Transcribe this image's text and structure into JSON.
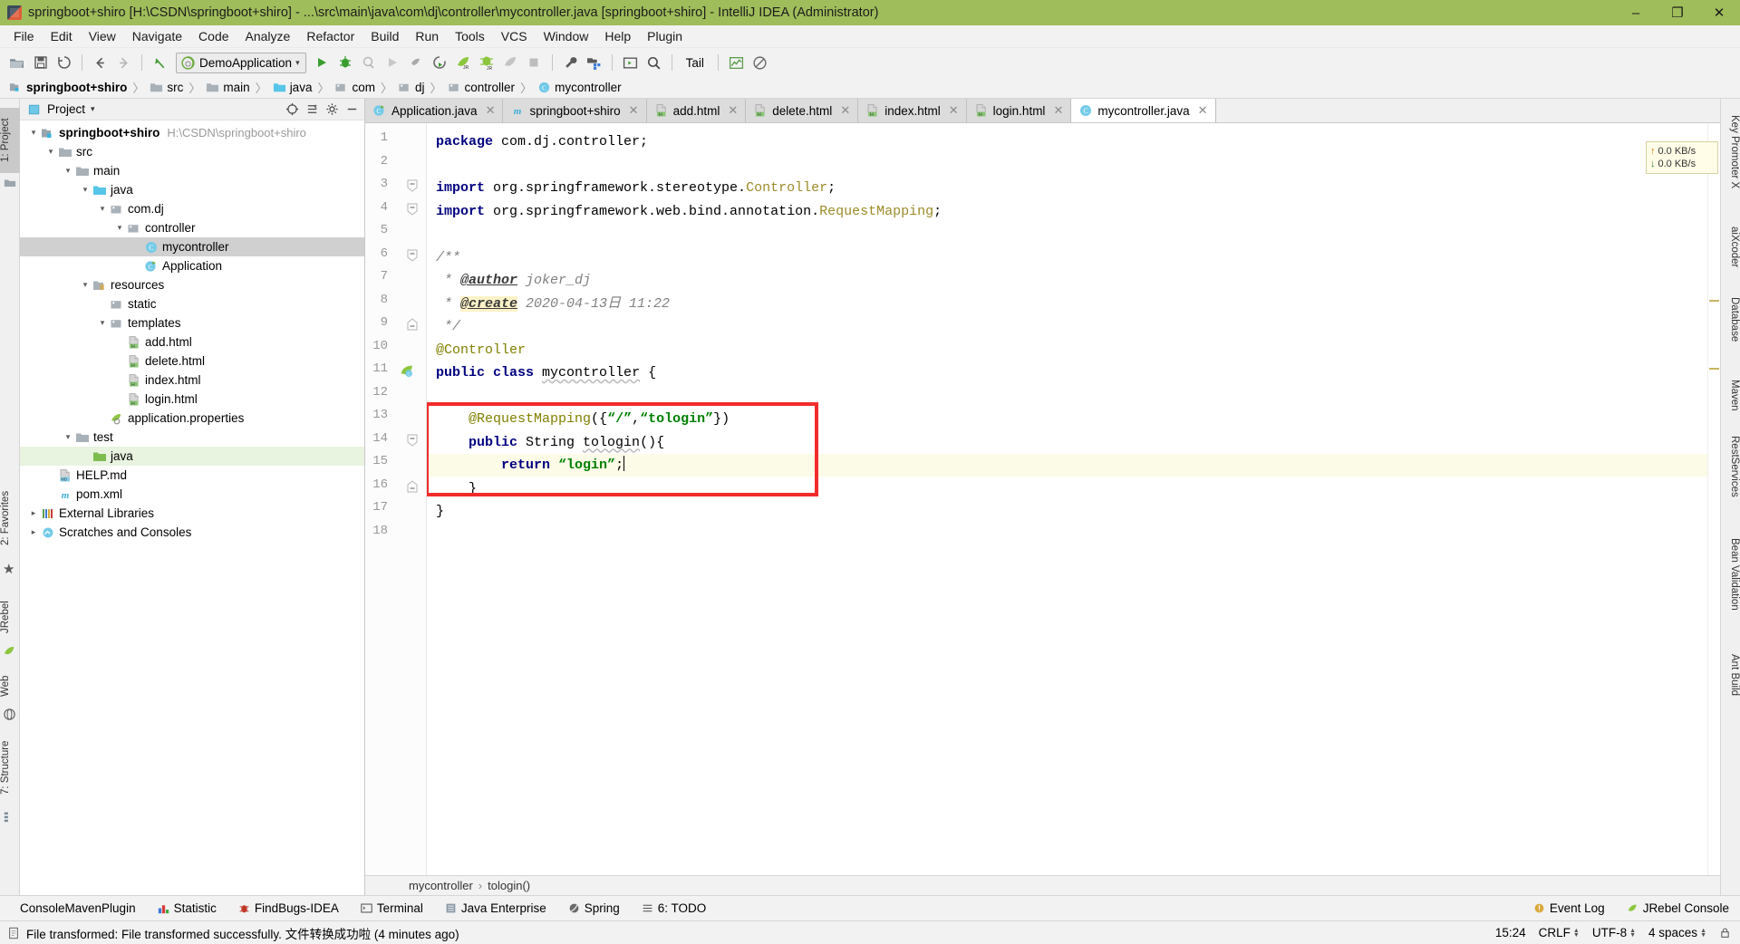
{
  "window": {
    "title": "springboot+shiro [H:\\CSDN\\springboot+shiro] - ...\\src\\main\\java\\com\\dj\\controller\\mycontroller.java [springboot+shiro] - IntelliJ IDEA (Administrator)",
    "minimize": "–",
    "maximize": "❐",
    "close": "✕",
    "titlebar_color": "#9fbd5a"
  },
  "menubar": {
    "items": [
      "File",
      "Edit",
      "View",
      "Navigate",
      "Code",
      "Analyze",
      "Refactor",
      "Build",
      "Run",
      "Tools",
      "VCS",
      "Window",
      "Help",
      "Plugin"
    ]
  },
  "toolbar": {
    "run_config": "DemoApplication",
    "tail_label": "Tail",
    "icons": [
      "open-folder-icon",
      "save-all-icon",
      "sync-icon",
      "back-arrow-icon",
      "forward-arrow-icon",
      "revert-icon",
      "run-icon",
      "debug-icon",
      "run-with-coverage-icon",
      "rerun-icon",
      "stop-gray-icon",
      "restart-icon",
      "jrebel-run-icon",
      "jrebel-debug-icon",
      "jrebel-gray-icon",
      "stop-icon",
      "wrench-icon",
      "project-structure-icon",
      "terminal-icon",
      "search-everywhere-icon"
    ]
  },
  "breadcrumb": {
    "items": [
      {
        "label": "springboot+shiro",
        "icon": "module-icon",
        "bold": true
      },
      {
        "label": "src",
        "icon": "folder-icon",
        "bold": false
      },
      {
        "label": "main",
        "icon": "folder-icon",
        "bold": false
      },
      {
        "label": "java",
        "icon": "source-folder-icon",
        "bold": false
      },
      {
        "label": "com",
        "icon": "package-icon",
        "bold": false
      },
      {
        "label": "dj",
        "icon": "package-icon",
        "bold": false
      },
      {
        "label": "controller",
        "icon": "package-icon",
        "bold": false
      },
      {
        "label": "mycontroller",
        "icon": "class-icon",
        "bold": false
      }
    ],
    "separator": "〉"
  },
  "project_panel": {
    "title": "Project",
    "dropdown_caret": "▾",
    "header_icons": [
      "locate-icon",
      "collapse-all-icon",
      "settings-gear-icon",
      "hide-icon"
    ],
    "tree": [
      {
        "depth": 0,
        "label": "springboot+shiro",
        "path": "H:\\CSDN\\springboot+shiro",
        "icon": "module-icon",
        "twist": "▾",
        "bold": true,
        "state": "normal"
      },
      {
        "depth": 1,
        "label": "src",
        "icon": "folder-icon",
        "twist": "▾",
        "bold": false,
        "state": "normal"
      },
      {
        "depth": 2,
        "label": "main",
        "icon": "folder-icon",
        "twist": "▾",
        "bold": false,
        "state": "normal"
      },
      {
        "depth": 3,
        "label": "java",
        "icon": "source-folder-icon",
        "twist": "▾",
        "bold": false,
        "state": "normal"
      },
      {
        "depth": 4,
        "label": "com.dj",
        "icon": "package-icon",
        "twist": "▾",
        "bold": false,
        "state": "normal"
      },
      {
        "depth": 5,
        "label": "controller",
        "icon": "package-icon",
        "twist": "▾",
        "bold": false,
        "state": "normal"
      },
      {
        "depth": 6,
        "label": "mycontroller",
        "icon": "class-icon",
        "twist": "",
        "bold": false,
        "state": "selected"
      },
      {
        "depth": 6,
        "label": "Application",
        "icon": "spring-class-icon",
        "twist": "",
        "bold": false,
        "state": "normal"
      },
      {
        "depth": 3,
        "label": "resources",
        "icon": "resources-folder-icon",
        "twist": "▾",
        "bold": false,
        "state": "normal"
      },
      {
        "depth": 4,
        "label": "static",
        "icon": "package-icon",
        "twist": "",
        "bold": false,
        "state": "normal"
      },
      {
        "depth": 4,
        "label": "templates",
        "icon": "package-icon",
        "twist": "▾",
        "bold": false,
        "state": "normal"
      },
      {
        "depth": 5,
        "label": "add.html",
        "icon": "html-file-icon",
        "twist": "",
        "bold": false,
        "state": "normal"
      },
      {
        "depth": 5,
        "label": "delete.html",
        "icon": "html-file-icon",
        "twist": "",
        "bold": false,
        "state": "normal"
      },
      {
        "depth": 5,
        "label": "index.html",
        "icon": "html-file-icon",
        "twist": "",
        "bold": false,
        "state": "normal"
      },
      {
        "depth": 5,
        "label": "login.html",
        "icon": "html-file-icon",
        "twist": "",
        "bold": false,
        "state": "normal"
      },
      {
        "depth": 4,
        "label": "application.properties",
        "icon": "spring-properties-icon",
        "twist": "",
        "bold": false,
        "state": "normal"
      },
      {
        "depth": 2,
        "label": "test",
        "icon": "folder-icon",
        "twist": "▾",
        "bold": false,
        "state": "normal"
      },
      {
        "depth": 3,
        "label": "java",
        "icon": "test-source-folder-icon",
        "twist": "",
        "bold": false,
        "state": "highlighted"
      },
      {
        "depth": 1,
        "label": "HELP.md",
        "icon": "markdown-file-icon",
        "twist": "",
        "bold": false,
        "state": "normal"
      },
      {
        "depth": 1,
        "label": "pom.xml",
        "icon": "maven-file-icon",
        "twist": "",
        "bold": false,
        "state": "normal"
      },
      {
        "depth": 0,
        "label": "External Libraries",
        "icon": "libraries-icon",
        "twist": "▸",
        "bold": false,
        "state": "normal"
      },
      {
        "depth": 0,
        "label": "Scratches and Consoles",
        "icon": "scratches-icon",
        "twist": "▸",
        "bold": false,
        "state": "normal"
      }
    ]
  },
  "left_strip": {
    "tabs": [
      {
        "label": "1: Project",
        "active": true,
        "icon": "project-icon"
      },
      {
        "label": "2: Favorites",
        "active": false,
        "icon": "star-icon"
      },
      {
        "label": "JRebel",
        "active": false,
        "icon": "jrebel-icon"
      },
      {
        "label": "Web",
        "active": false,
        "icon": "web-icon"
      },
      {
        "label": "7: Structure",
        "active": false,
        "icon": "structure-icon"
      }
    ]
  },
  "right_strip": {
    "tabs": [
      {
        "label": "Key Promoter X"
      },
      {
        "label": "aiXcoder"
      },
      {
        "label": "Database"
      },
      {
        "label": "Maven"
      },
      {
        "label": "RestServices"
      },
      {
        "label": "Bean Validation"
      },
      {
        "label": "Ant Build"
      }
    ]
  },
  "editor_tabs": [
    {
      "label": "Application.java",
      "icon": "spring-class-icon",
      "active": false
    },
    {
      "label": "springboot+shiro",
      "icon": "maven-file-icon",
      "active": false
    },
    {
      "label": "add.html",
      "icon": "html-file-icon",
      "active": false
    },
    {
      "label": "delete.html",
      "icon": "html-file-icon",
      "active": false
    },
    {
      "label": "index.html",
      "icon": "html-file-icon",
      "active": false
    },
    {
      "label": "login.html",
      "icon": "html-file-icon",
      "active": false
    },
    {
      "label": "mycontroller.java",
      "icon": "class-icon",
      "active": true
    }
  ],
  "editor": {
    "line_count": 18,
    "lines": [
      {
        "n": 1,
        "text": "package com.dj.controller;"
      },
      {
        "n": 2,
        "text": ""
      },
      {
        "n": 3,
        "text": "import org.springframework.stereotype.Controller;"
      },
      {
        "n": 4,
        "text": "import org.springframework.web.bind.annotation.RequestMapping;"
      },
      {
        "n": 5,
        "text": ""
      },
      {
        "n": 6,
        "text": "/**"
      },
      {
        "n": 7,
        "text": " * @author joker_dj"
      },
      {
        "n": 8,
        "text": " * @create 2020-04-13日 11:22"
      },
      {
        "n": 9,
        "text": " */"
      },
      {
        "n": 10,
        "text": "@Controller"
      },
      {
        "n": 11,
        "text": "public class mycontroller {"
      },
      {
        "n": 12,
        "text": ""
      },
      {
        "n": 13,
        "text": "    @RequestMapping({“/”,“tologin”})"
      },
      {
        "n": 14,
        "text": "    public String tologin(){"
      },
      {
        "n": 15,
        "text": "        return “login”;"
      },
      {
        "n": 16,
        "text": "    }"
      },
      {
        "n": 17,
        "text": "}"
      },
      {
        "n": 18,
        "text": ""
      }
    ],
    "highlight_line": 15,
    "caret_line": 15,
    "red_box_lines": [
      13,
      16
    ],
    "network_popup": {
      "upload": "0.0 KB/s",
      "download": "0.0 KB/s",
      "up_arrow": "↑",
      "down_arrow": "↓"
    }
  },
  "editor_breadcrumb": {
    "items": [
      "mycontroller",
      "tologin()"
    ],
    "separator": "›"
  },
  "bottom_bar": {
    "items": [
      {
        "label": "ConsoleMavenPlugin",
        "icon": ""
      },
      {
        "label": "Statistic",
        "icon": "statistic-icon"
      },
      {
        "label": "FindBugs-IDEA",
        "icon": "findbugs-icon"
      },
      {
        "label": "Terminal",
        "icon": "terminal-icon"
      },
      {
        "label": "Java Enterprise",
        "icon": "java-enterprise-icon"
      },
      {
        "label": "Spring",
        "icon": "spring-icon"
      },
      {
        "label": "6: TODO",
        "icon": "todo-icon"
      }
    ],
    "right_items": [
      {
        "label": "Event Log",
        "icon": "event-log-icon"
      },
      {
        "label": "JRebel Console",
        "icon": "jrebel-icon"
      }
    ]
  },
  "status_bar": {
    "message": "File transformed: File transformed successfully. 文件转换成功啦 (4 minutes ago)",
    "message_icon": "document-icon",
    "time": "15:24",
    "line_sep": "CRLF",
    "encoding": "UTF-8",
    "indent": "4 spaces",
    "lock_icon": "lock-icon"
  }
}
